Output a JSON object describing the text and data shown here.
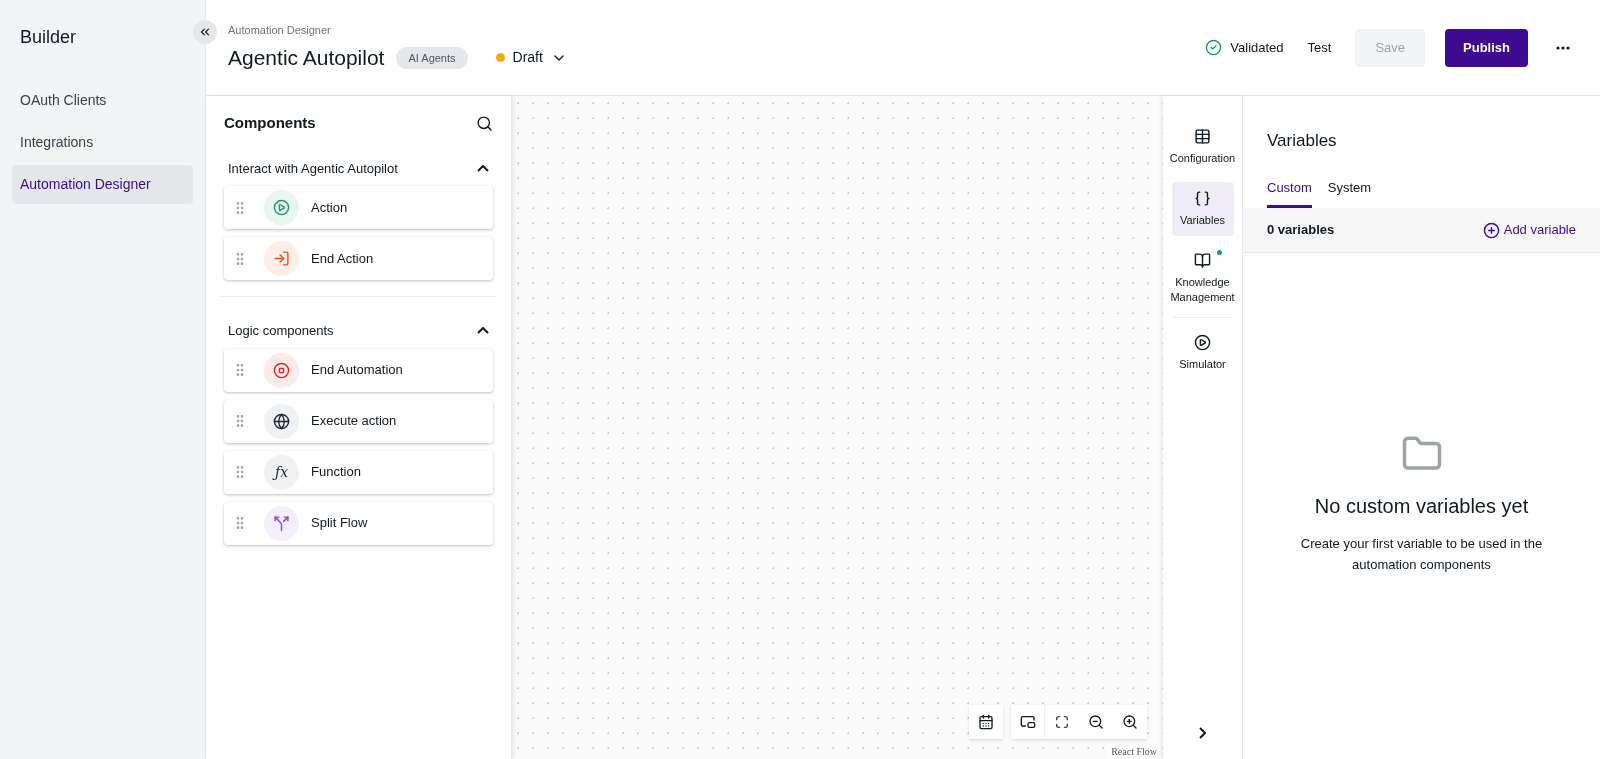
{
  "sidebar": {
    "title": "Builder",
    "items": [
      {
        "label": "OAuth Clients",
        "selected": false
      },
      {
        "label": "Integrations",
        "selected": false
      },
      {
        "label": "Automation Designer",
        "selected": true
      }
    ]
  },
  "header": {
    "breadcrumb": "Automation Designer",
    "title": "Agentic Autopilot",
    "tag": "AI Agents",
    "status": {
      "label": "Draft",
      "color": "#f0a81c"
    },
    "validation": "Validated",
    "test": "Test",
    "save": {
      "label": "Save",
      "disabled": true
    },
    "publish": "Publish"
  },
  "components": {
    "title": "Components",
    "sections": [
      {
        "title": "Interact with Agentic Autopilot",
        "expanded": true,
        "items": [
          {
            "label": "Action",
            "kind": "action"
          },
          {
            "label": "End Action",
            "kind": "end-action"
          }
        ]
      },
      {
        "title": "Logic components",
        "expanded": true,
        "items": [
          {
            "label": "End Automation",
            "kind": "stop"
          },
          {
            "label": "Execute action",
            "kind": "globe"
          },
          {
            "label": "Function",
            "kind": "function",
            "glyph": "ƒx"
          },
          {
            "label": "Split Flow",
            "kind": "split"
          }
        ]
      }
    ]
  },
  "canvas": {
    "attribution": "React Flow"
  },
  "rail": [
    {
      "label": "Configuration",
      "kind": "config",
      "selected": false,
      "notification": false
    },
    {
      "label": "Variables",
      "kind": "variables",
      "selected": true,
      "notification": false
    },
    {
      "label": "Knowledge Management",
      "kind": "book",
      "selected": false,
      "notification": true
    },
    {
      "label": "Simulator",
      "kind": "play",
      "selected": false,
      "notification": false
    }
  ],
  "variables": {
    "title": "Variables",
    "tabs": [
      {
        "label": "Custom",
        "selected": true
      },
      {
        "label": "System",
        "selected": false
      }
    ],
    "count": "0 variables",
    "add": "Add variable",
    "empty_title": "No custom variables yet",
    "empty_text": "Create your first variable to be used in the automation components"
  }
}
